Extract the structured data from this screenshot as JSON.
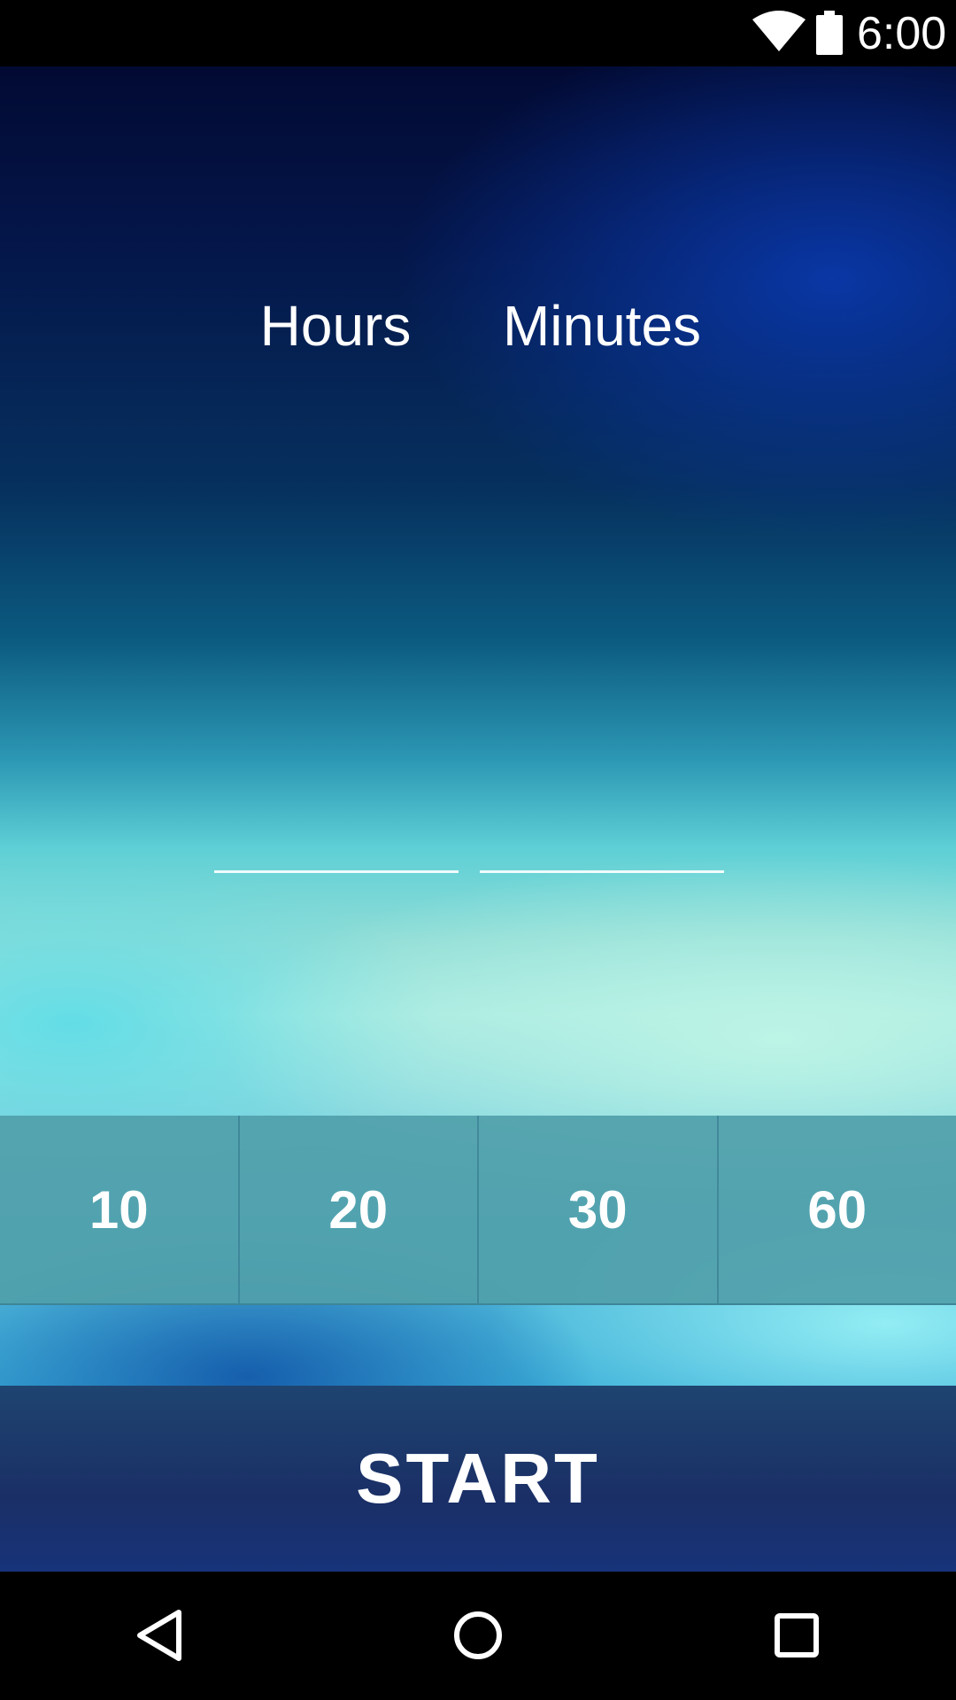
{
  "status_bar": {
    "time": "6:00",
    "wifi_icon": "wifi-icon",
    "battery_icon": "battery-icon"
  },
  "timer": {
    "hours_label": "Hours",
    "minutes_label": "Minutes",
    "hours_value": "",
    "minutes_value": ""
  },
  "presets": [
    {
      "label": "10"
    },
    {
      "label": "20"
    },
    {
      "label": "30"
    },
    {
      "label": "60"
    }
  ],
  "start_label": "START",
  "nav_bar": {
    "back_icon": "back-triangle-icon",
    "home_icon": "home-circle-icon",
    "recents_icon": "recents-square-icon"
  },
  "colors": {
    "preset_bar": "#50a0aa",
    "start_button": "#1a2f66",
    "text": "#ffffff"
  }
}
